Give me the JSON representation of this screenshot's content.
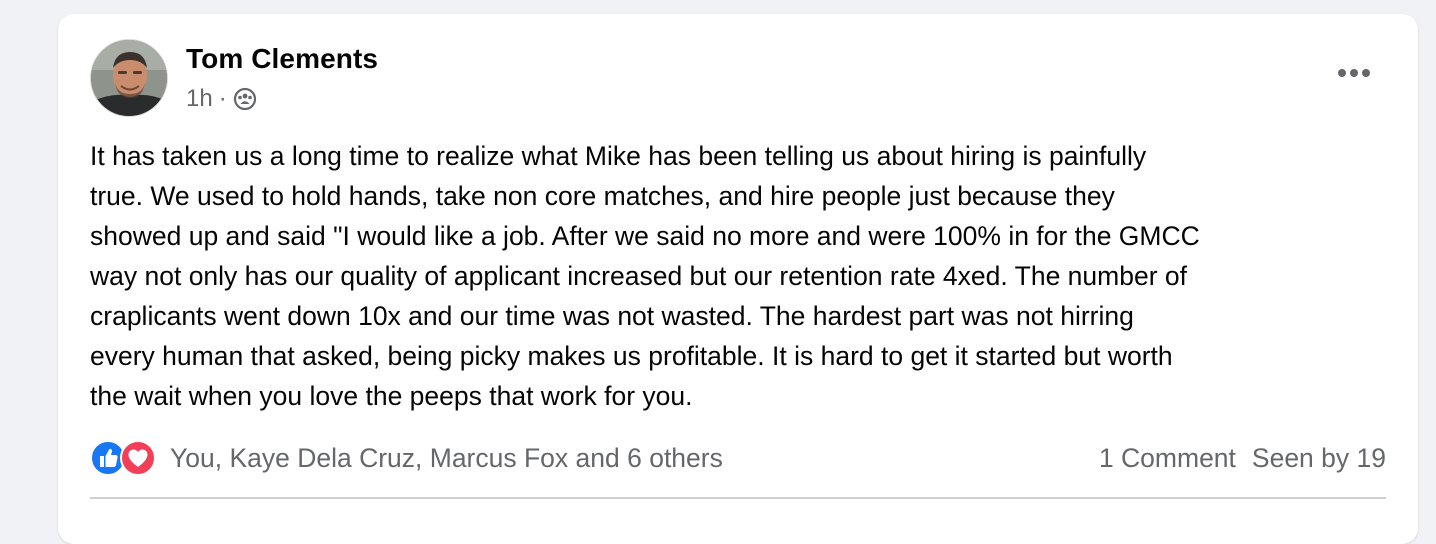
{
  "post": {
    "author_name": "Tom Clements",
    "timestamp": "1h",
    "separator": "·",
    "audience_icon": "group-audience-icon",
    "more_icon": "more-horizontal-icon",
    "body": "It has taken us a long time to realize what Mike has been telling us about hiring is painfully\ntrue. We used to hold hands, take non core matches, and hire people just because they\nshowed up and said \"I would like a job. After we said no more and were 100% in for the GMCC\nway not only has our quality of applicant increased but our retention rate 4xed. The number of\ncraplicants went down 10x and our time was not wasted. The hardest part was not hirring\nevery human that asked, being picky makes us profitable. It is hard to get it started but worth\nthe wait when you love the peeps that work for you."
  },
  "reactions": {
    "icons": [
      "like-reaction-icon",
      "love-reaction-icon"
    ],
    "summary": "You, Kaye Dela Cruz, Marcus Fox and 6 others",
    "like_color": "#1877f2",
    "love_color": "#f33e58"
  },
  "stats": {
    "comments": "1 Comment",
    "seen_by": "Seen by 19"
  }
}
